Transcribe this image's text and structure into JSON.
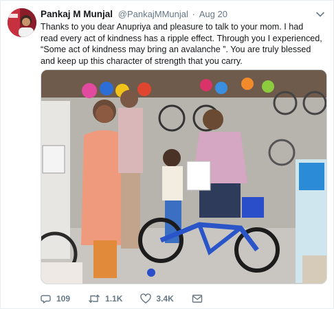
{
  "tweet": {
    "author_name": "Pankaj M Munjal",
    "handle": "@PankajMMunjal",
    "separator": "·",
    "date": "Aug 20",
    "text": "Thanks to you dear Anupriya and pleasure to talk to your mom. I had read every act of kindness has a ripple effect. Through you I experienced, “Some act of kindness may bring an avalanche ”. You are truly blessed and keep up this character of strength that you carry."
  },
  "actions": {
    "replies": "109",
    "retweets": "1.1K",
    "likes": "3.4K"
  },
  "icons": {
    "caret": "chevron-down-icon",
    "reply": "reply-icon",
    "retweet": "retweet-icon",
    "like": "heart-icon",
    "message": "envelope-icon"
  },
  "colors": {
    "text": "#14171a",
    "secondary": "#657786",
    "border": "#e6ecf0"
  }
}
